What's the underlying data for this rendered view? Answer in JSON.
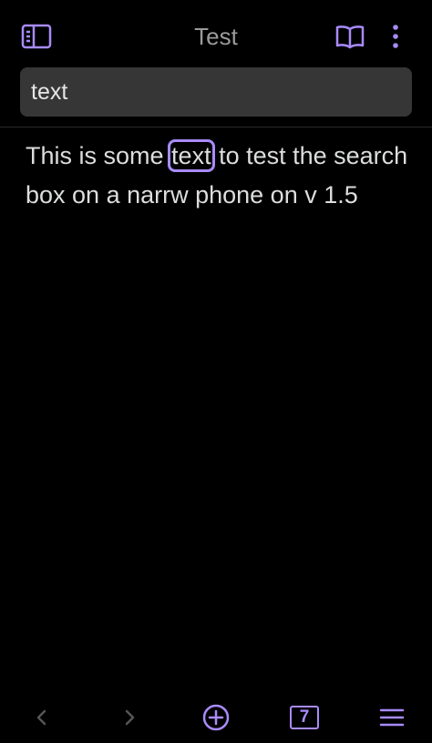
{
  "header": {
    "title": "Test",
    "left_icon": "sidebar-toggle-icon",
    "right_icons": [
      "reading-view-icon",
      "more-options-icon"
    ]
  },
  "search": {
    "value": "text",
    "placeholder": ""
  },
  "content": {
    "before": "This is some ",
    "match": "text",
    "after": " to test the search box on a narrw phone on v 1.5"
  },
  "bottom_bar": {
    "icons": [
      "back-icon",
      "forward-icon",
      "new-note-icon",
      "tab-switcher-icon",
      "menu-icon"
    ],
    "tab_count": "7"
  },
  "colors": {
    "accent": "#a88bfa",
    "background": "#000000",
    "search_bg": "#363636",
    "text": "#dcddde",
    "muted": "#9a9a9a",
    "disabled": "#555555"
  }
}
